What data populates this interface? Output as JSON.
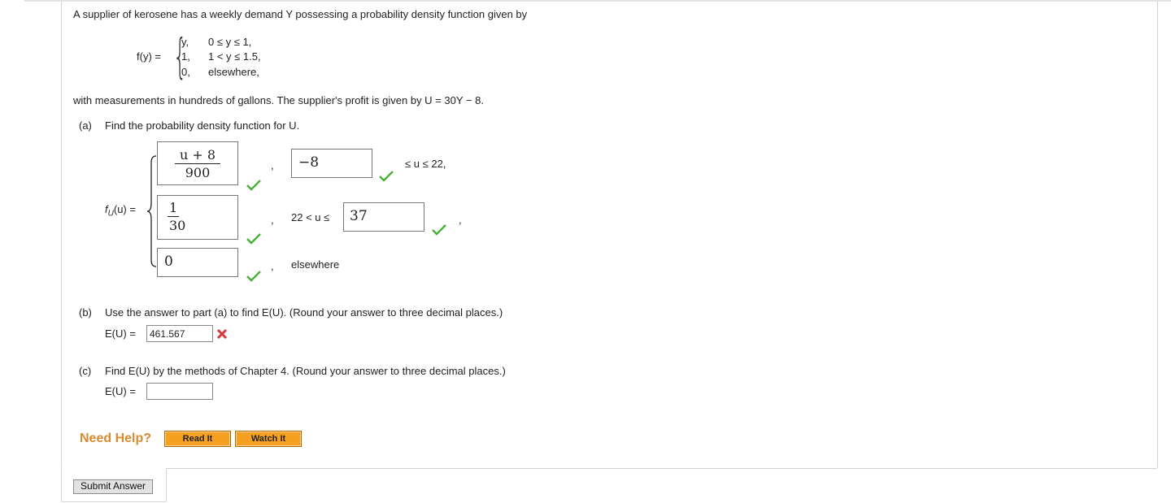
{
  "problem": {
    "intro": "A supplier of kerosene has a weekly demand Y possessing a probability density function given by",
    "fy_label": "f(y) =",
    "piecewise": [
      {
        "value": "y,",
        "condition": "0 ≤ y ≤ 1,"
      },
      {
        "value": "1,",
        "condition": "1 < y ≤ 1.5,"
      },
      {
        "value": "0,",
        "condition": "elsewhere,"
      }
    ],
    "measure_text": "with measurements in hundreds of gallons. The supplier's profit is given by U = 30Y − 8."
  },
  "part_a": {
    "letter": "(a)",
    "question": "Find the probability density function for U.",
    "fu_label": "f",
    "fu_sub": "U",
    "fu_arg": "(u) =",
    "row1": {
      "num": "u + 8",
      "den": "900",
      "comma": ",",
      "lower": "−8",
      "range": "≤ u ≤ 22,"
    },
    "row2": {
      "num": "1",
      "den": "30",
      "comma": ",",
      "range": "22 < u ≤",
      "upper": "37",
      "trail": ","
    },
    "row3": {
      "value": "0",
      "comma": ",",
      "range": "elsewhere"
    }
  },
  "part_b": {
    "letter": "(b)",
    "question": "Use the answer to part (a) to find E(U). (Round your answer to three decimal places.)",
    "label": "E(U) =",
    "value": "461.567"
  },
  "part_c": {
    "letter": "(c)",
    "question": "Find E(U) by the methods of Chapter 4. (Round your answer to three decimal places.)",
    "label": "E(U) =",
    "value": ""
  },
  "help": {
    "title": "Need Help?",
    "read_label": "Read It",
    "watch_label": "Watch It"
  },
  "submit_label": "Submit Answer",
  "colors": {
    "check": "#4caf3a",
    "wrong": "#d9363e",
    "help_title": "#d98b2f",
    "help_button": "#f5a020"
  }
}
